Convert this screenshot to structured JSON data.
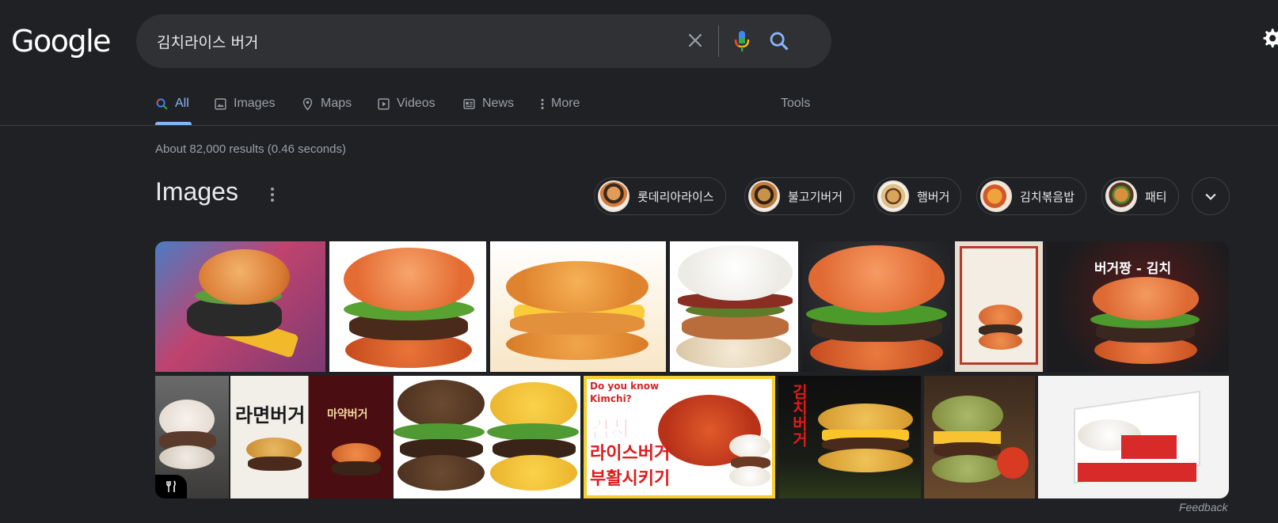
{
  "logo": "Google",
  "search": {
    "query": "김치라이스 버거"
  },
  "tabs": [
    {
      "label": "All",
      "icon": "search-icon",
      "active": true
    },
    {
      "label": "Images",
      "icon": "image-icon"
    },
    {
      "label": "Maps",
      "icon": "map-pin-icon"
    },
    {
      "label": "Videos",
      "icon": "play-icon"
    },
    {
      "label": "News",
      "icon": "news-icon"
    },
    {
      "label": "More",
      "icon": "vertical-dots-icon"
    }
  ],
  "tools_label": "Tools",
  "result_stats": "About 82,000 results (0.46 seconds)",
  "images_section": {
    "title": "Images",
    "chips": [
      {
        "label": "롯데리아라이스"
      },
      {
        "label": "불고기버거"
      },
      {
        "label": "햄버거"
      },
      {
        "label": "김치볶음밥"
      },
      {
        "label": "패티"
      }
    ],
    "overlay_texts": {
      "t7": "버거짱 - 김치",
      "t9": "라면버거",
      "t10": "마약버거",
      "t12a": "Do you know",
      "t12b": "Kimchi?",
      "t12c": "김치",
      "t12d": "라이스버거",
      "t12e": "부활시키기",
      "t13": "김치버거"
    }
  },
  "feedback_label": "Feedback",
  "colors": {
    "background": "#202124",
    "searchbox": "#303134",
    "accent": "#8ab4f8",
    "text_muted": "#9aa0a6"
  }
}
